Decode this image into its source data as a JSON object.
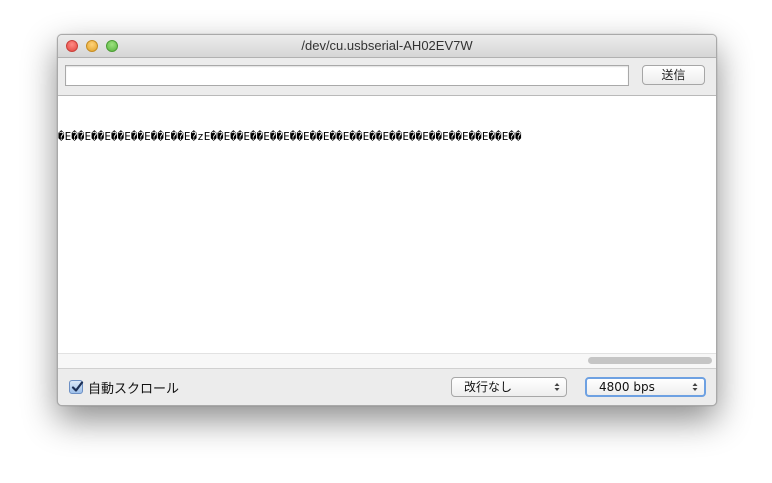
{
  "window": {
    "title": "/dev/cu.usbserial-AH02EV7W"
  },
  "toolbar": {
    "input_value": "",
    "send_label": "送信"
  },
  "output": {
    "text": "�E��E��E��E��E��E��E�zE��E��E��E��E��E��E��E��E��E��E��E��E��E��E��E��"
  },
  "bottom": {
    "autoscroll_label": "自動スクロール",
    "autoscroll_checked": true,
    "line_ending": "改行なし",
    "baud_rate": "4800 bps"
  },
  "colors": {
    "close": "#e2463f",
    "minimize": "#e1a22a",
    "maximize": "#59b43f",
    "focus_ring": "#6ea1e2"
  },
  "icons": {
    "close": "close-icon",
    "minimize": "minimize-icon",
    "maximize": "maximize-icon",
    "checkbox": "check-icon",
    "select_arrows": "chevron-updown-icon"
  }
}
